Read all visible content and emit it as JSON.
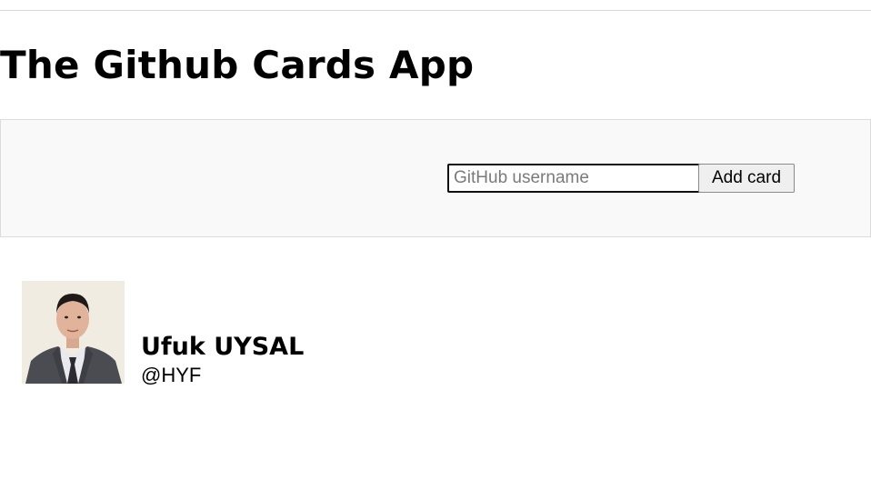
{
  "app": {
    "title": "The Github Cards App"
  },
  "form": {
    "username_placeholder": "GitHub username",
    "username_value": "",
    "add_button_label": "Add card"
  },
  "cards": [
    {
      "name": "Ufuk UYSAL",
      "handle": "@HYF",
      "avatar": "profile-photo"
    }
  ]
}
